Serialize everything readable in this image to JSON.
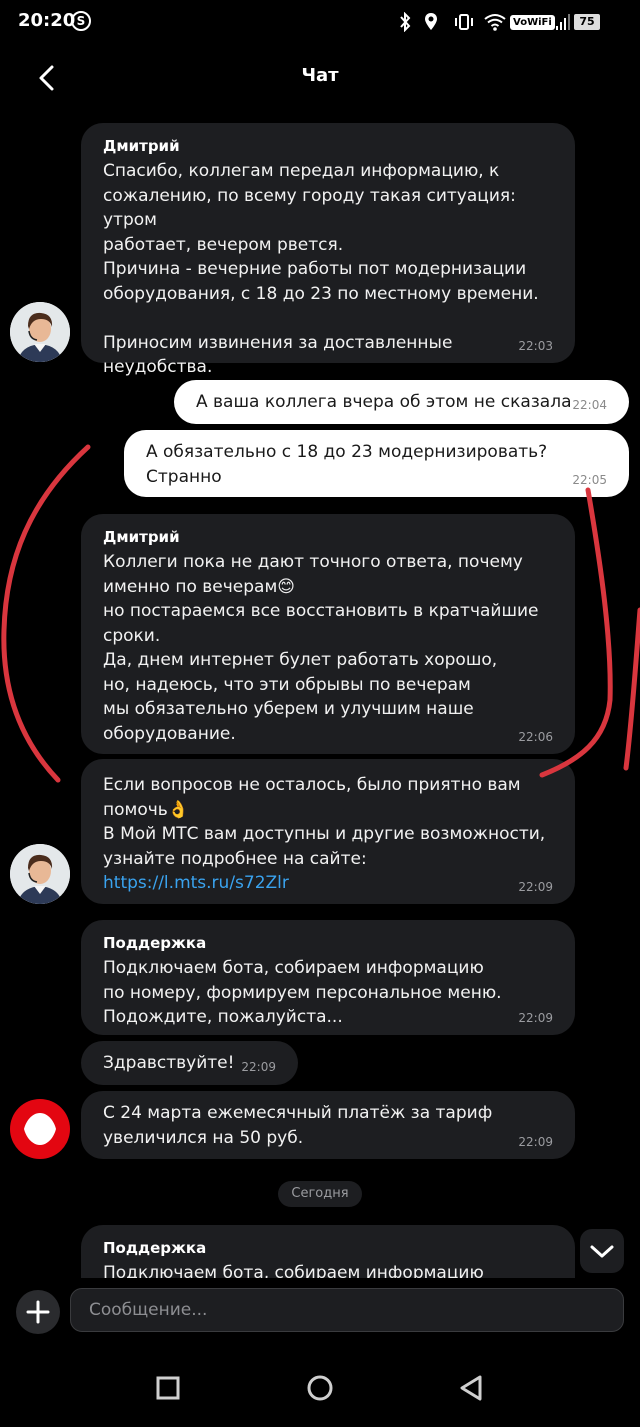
{
  "status_bar": {
    "time": "20:20",
    "app_badge": "S",
    "network_label": "VoWiFi",
    "battery": "75"
  },
  "header": {
    "title": "Чат"
  },
  "messages": [
    {
      "sender": "Дмитрий",
      "text": "Спасибо, коллегам передал информацию, к\nсожалению, по всему городу такая ситуация: утром\nработает, вечером рвется.\nПричина - вечерние работы пот модернизации\nоборудования, с 18 до 23 по местному времени.\n\nПриносим извинения за доставленные неудобства.",
      "time": "22:03"
    },
    {
      "text": "А ваша коллега вчера об этом не сказала",
      "time": "22:04"
    },
    {
      "text": "А обязательно с 18 до 23 модернизировать?\nСтранно",
      "time": "22:05"
    },
    {
      "sender": "Дмитрий",
      "text": "Коллеги пока не дают точного ответа, почему\nименно по вечерам😊\nно постараемся все восстановить в кратчайшие\nсроки.\nДа, днем интернет булет работать хорошо,\nно, надеюсь, что эти обрывы по вечерам\nмы обязательно уберем и улучшим наше\nоборудование.",
      "time": "22:06"
    },
    {
      "text_before_link": "Если вопросов не осталось, было приятно вам\nпомочь👌\nВ Мой МТС вам доступны и другие возможности,\nузнайте подробнее на сайте: ",
      "link": "https://l.mts.ru/s72Zlr",
      "time": "22:09"
    },
    {
      "sender": "Поддержка",
      "text": "Подключаем бота, собираем информацию\nпо номеру, формируем персональное меню.\nПодождите, пожалуйста...",
      "time": "22:09"
    },
    {
      "text": "Здравствуйте!",
      "time": "22:09"
    },
    {
      "text": "С 24 марта ежемесячный платёж за тариф\nувеличился на 50 руб.",
      "time": "22:09"
    },
    {
      "sender": "Поддержка",
      "text": "Подключаем бота, собираем информацию"
    }
  ],
  "date_separator": "Сегодня",
  "composer": {
    "placeholder": "Сообщение..."
  },
  "colors": {
    "background": "#000000",
    "incoming_bubble": "#1d1e21",
    "outgoing_bubble": "#ffffff",
    "link": "#3aa3ef",
    "brand_red": "#e30611",
    "annotation_red": "#d9363e"
  }
}
